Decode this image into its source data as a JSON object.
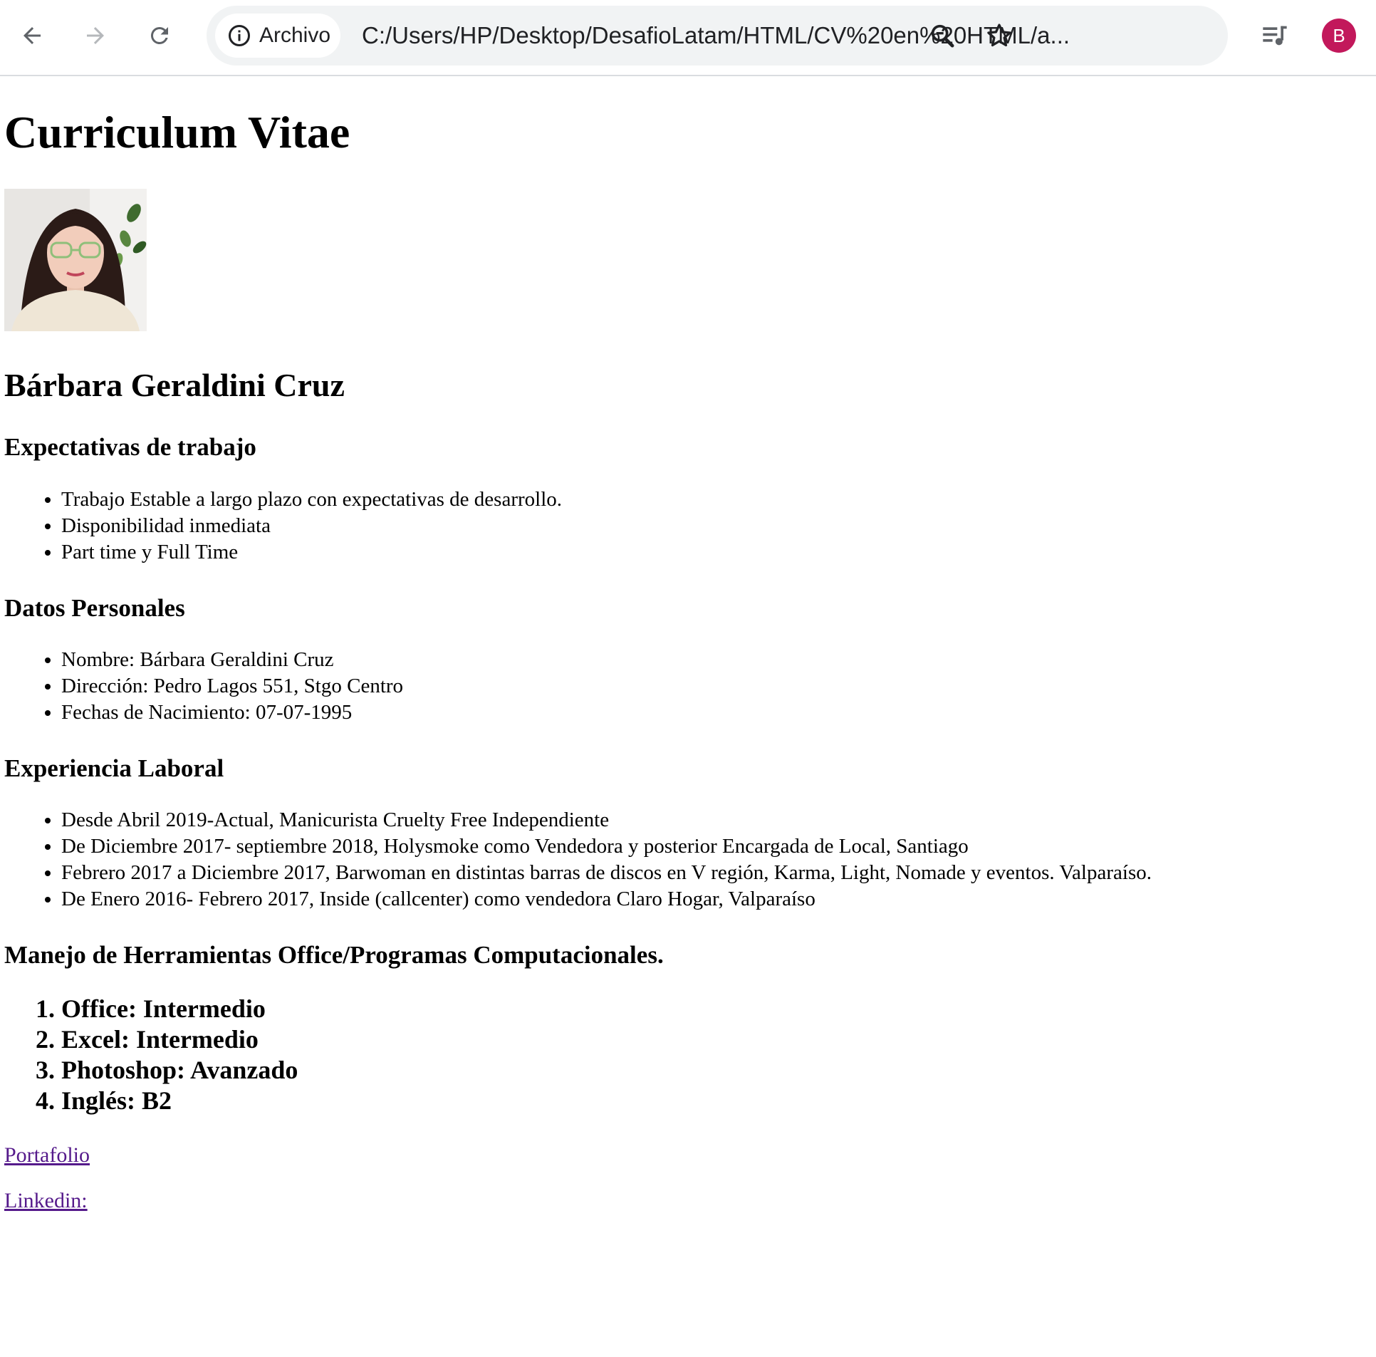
{
  "browser": {
    "site_chip_label": "Archivo",
    "url": "C:/Users/HP/Desktop/DesafioLatam/HTML/CV%20en%20HTML/a...",
    "profile_initial": "B",
    "profile_color": "#c2185b",
    "icons": [
      "back-arrow-icon",
      "forward-arrow-icon",
      "reload-icon",
      "info-icon",
      "zoom-icon",
      "star-icon",
      "media-queue-icon"
    ]
  },
  "page": {
    "title": "Curriculum Vitae",
    "name": "Bárbara Geraldini Cruz",
    "sections": {
      "expectativas": {
        "heading": "Expectativas de trabajo",
        "items": [
          "Trabajo Estable a largo plazo con expectativas de desarrollo.",
          "Disponibilidad inmediata",
          "Part time y Full Time"
        ]
      },
      "datos": {
        "heading": "Datos Personales",
        "items": [
          "Nombre: Bárbara Geraldini Cruz",
          "Dirección: Pedro Lagos 551, Stgo Centro",
          "Fechas de Nacimiento: 07-07-1995"
        ]
      },
      "experiencia": {
        "heading": "Experiencia Laboral",
        "items": [
          "Desde Abril 2019-Actual, Manicurista Cruelty Free Independiente",
          "De Diciembre 2017- septiembre 2018, Holysmoke como Vendedora y posterior Encargada de Local, Santiago",
          "Febrero 2017 a Diciembre 2017, Barwoman en distintas barras de discos en V región, Karma, Light, Nomade y eventos. Valparaíso.",
          "De Enero 2016- Febrero 2017, Inside (callcenter) como vendedora Claro Hogar, Valparaíso"
        ]
      },
      "herramientas": {
        "heading": "Manejo de Herramientas Office/Programas Computacionales.",
        "items": [
          "Office: Intermedio",
          "Excel: Intermedio",
          "Photoshop: Avanzado",
          "Inglés: B2"
        ]
      }
    },
    "links": {
      "portafolio": "Portafolio",
      "linkedin": "Linkedin:"
    }
  }
}
